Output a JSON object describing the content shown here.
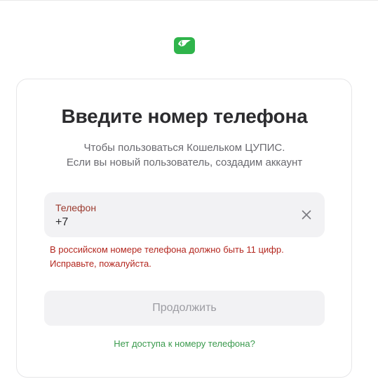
{
  "brand": {
    "logo_icon": "wallet-logo-icon",
    "accent": "#2fb44b"
  },
  "header": {
    "title": "Введите номер телефона",
    "subtitle_line1": "Чтобы пользоваться Кошельком ЦУПИС.",
    "subtitle_line2": "Если вы новый пользователь, создадим аккаунт"
  },
  "phone_field": {
    "label": "Телефон",
    "value": "+7",
    "clear_icon": "close-icon",
    "label_color": "#9b3a2e"
  },
  "error": {
    "line1": "В российском номере телефона должно быть 11 цифр.",
    "line2": "Исправьте, пожалуйста.",
    "color": "#b3261e"
  },
  "actions": {
    "continue_label": "Продолжить",
    "continue_disabled": true,
    "no_access_link": "Нет доступа к номеру телефона?"
  }
}
